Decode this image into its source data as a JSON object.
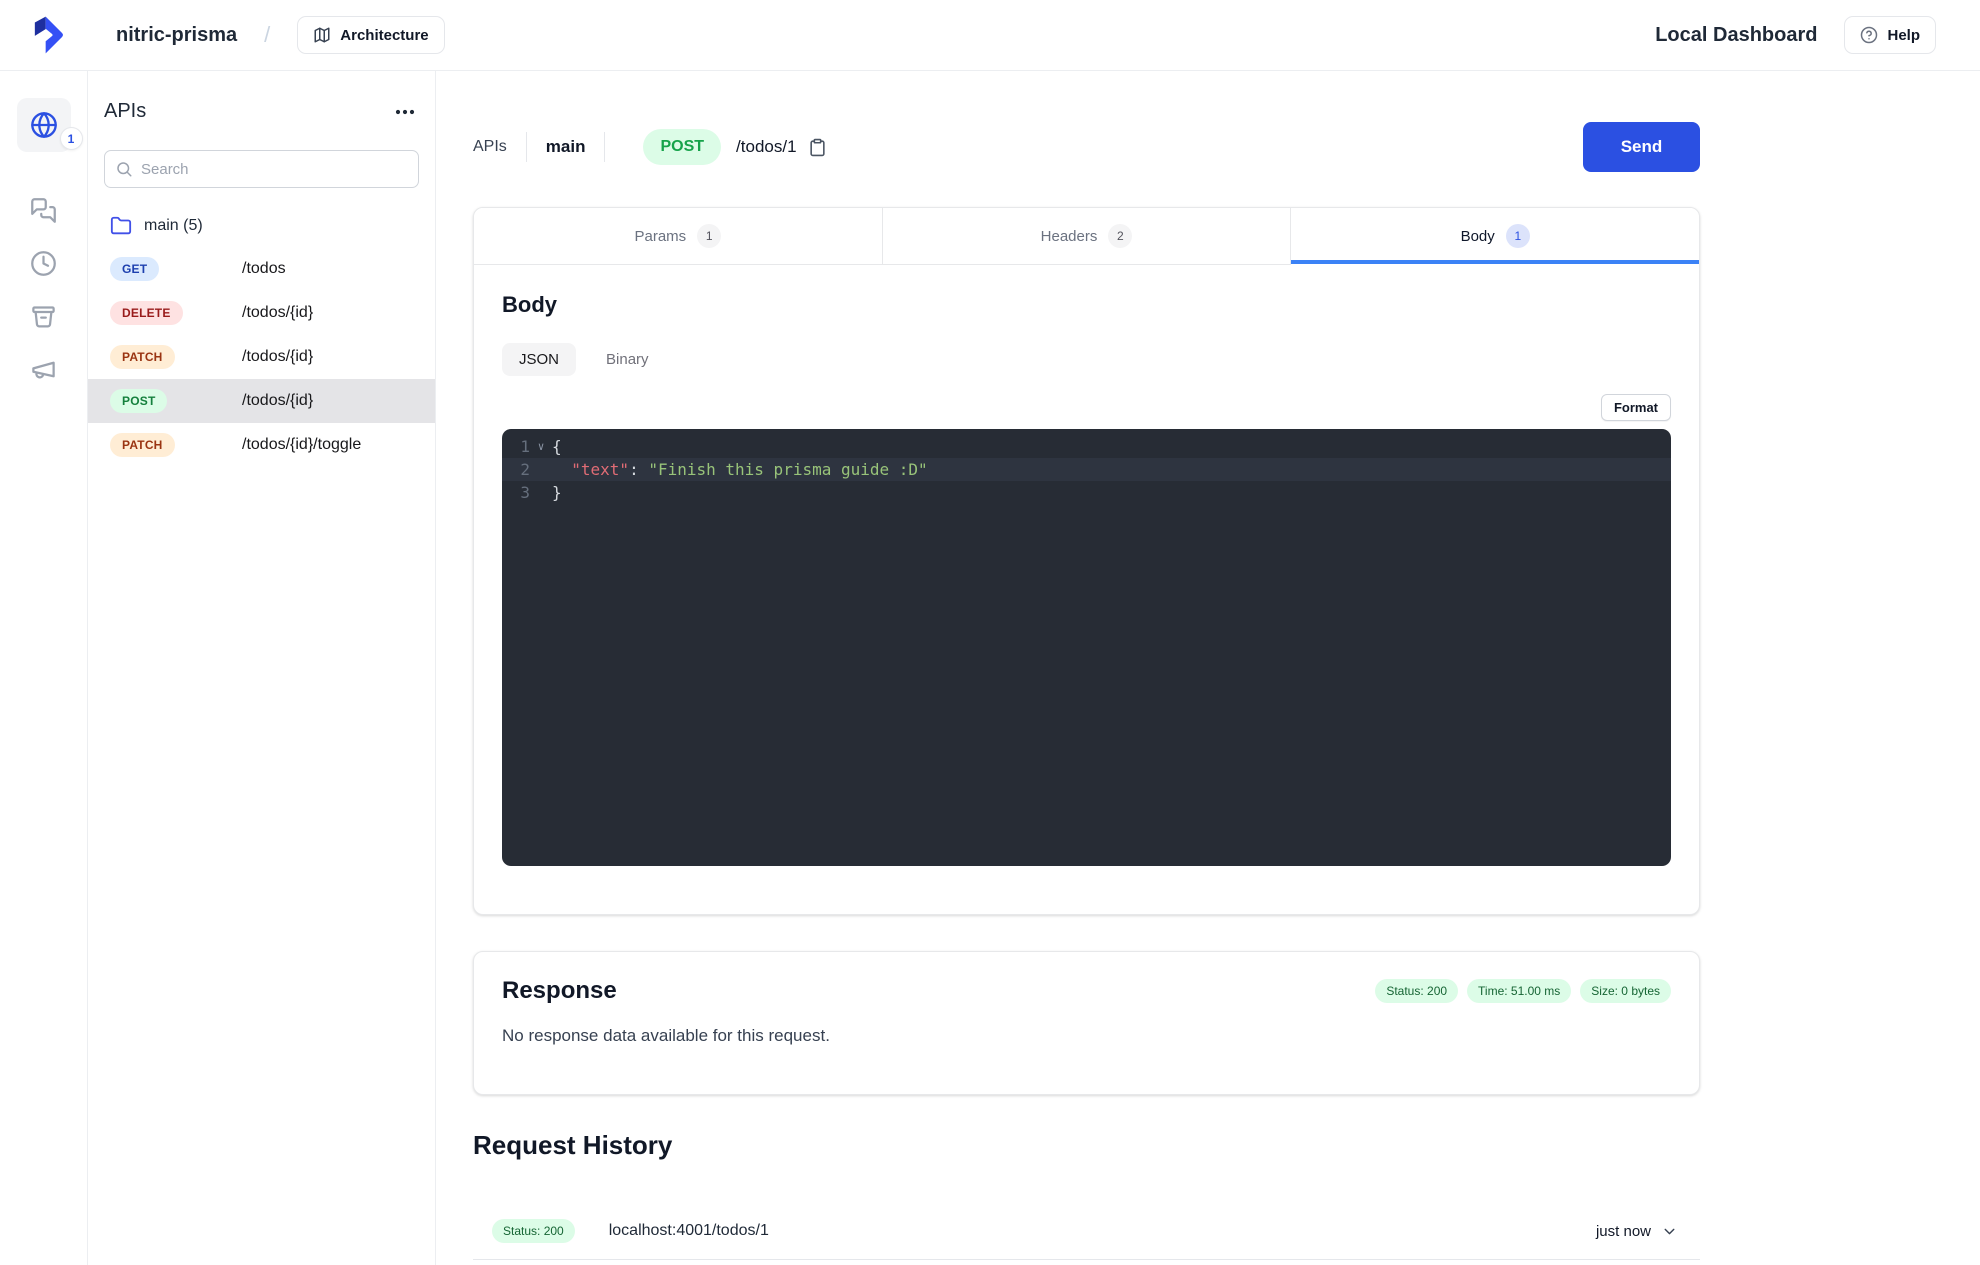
{
  "topbar": {
    "project": "nitric-prisma",
    "separator": "/",
    "architecture": "Architecture",
    "dashboard_title": "Local Dashboard",
    "help": "Help"
  },
  "rail": {
    "apis_count": "1"
  },
  "sidebar": {
    "title": "APIs",
    "search_placeholder": "Search",
    "group_label": "main (5)",
    "endpoints": [
      {
        "method": "GET",
        "path": "/todos"
      },
      {
        "method": "DELETE",
        "path": "/todos/{id}"
      },
      {
        "method": "PATCH",
        "path": "/todos/{id}"
      },
      {
        "method": "POST",
        "path": "/todos/{id}"
      },
      {
        "method": "PATCH",
        "path": "/todos/{id}/toggle"
      }
    ]
  },
  "request": {
    "breadcrumb": {
      "root": "APIs",
      "api": "main",
      "method": "POST",
      "path": "/todos/1"
    },
    "send": "Send",
    "tabs": [
      {
        "label": "Params",
        "count": "1"
      },
      {
        "label": "Headers",
        "count": "2"
      },
      {
        "label": "Body",
        "count": "1"
      }
    ]
  },
  "body_panel": {
    "title": "Body",
    "mode_json": "JSON",
    "mode_binary": "Binary",
    "format": "Format",
    "editor": {
      "line1": {
        "num": "1",
        "collapse": "∨",
        "code": "{"
      },
      "line2": {
        "num": "2",
        "property": "  \"text\"",
        "colon": ": ",
        "value": "\"Finish this prisma guide :D\""
      },
      "line3": {
        "num": "3",
        "code": "}"
      }
    }
  },
  "response": {
    "title": "Response",
    "status": "Status: 200",
    "time": "Time: 51.00 ms",
    "size": "Size: 0 bytes",
    "empty": "No response data available for this request."
  },
  "history": {
    "title": "Request History",
    "items": [
      {
        "status": "Status: 200",
        "url": "localhost:4001/todos/1",
        "time": "just now"
      }
    ]
  },
  "colors": {
    "accent": "#2b50e2",
    "tab_underline": "#3b82f6",
    "success_bg": "#dcfce7",
    "success_text": "#166534",
    "editor_bg": "#272c35",
    "editor_property": "#e06c75",
    "editor_string": "#98c379"
  }
}
